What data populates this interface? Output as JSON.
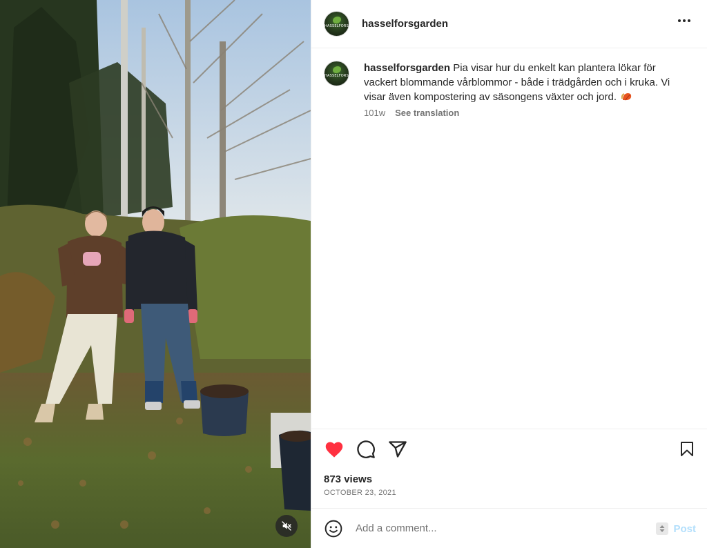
{
  "post": {
    "username": "hasselforsgarden",
    "avatar_logo_text": "HASSELFORS"
  },
  "caption": {
    "username": "hasselforsgarden",
    "text": "Pia visar hur du enkelt kan plantera lökar för vackert blommande vårblommor - både i trädgården och i kruka. Vi visar även kompostering av säsongens växter och jord.",
    "emoji": "fallen-leaf-emoji",
    "age": "101w",
    "see_translation": "See translation"
  },
  "actions": {
    "liked": true,
    "like_color": "#ff3040",
    "views": "873 views",
    "date": "OCTOBER 23, 2021"
  },
  "comment": {
    "placeholder": "Add a comment...",
    "post_label": "Post"
  },
  "icons": {
    "more": "more-options-icon",
    "like": "heart-icon",
    "comment": "comment-icon",
    "share": "share-icon",
    "save": "bookmark-icon",
    "emoji": "emoji-icon",
    "mute": "muted-speaker-icon"
  }
}
